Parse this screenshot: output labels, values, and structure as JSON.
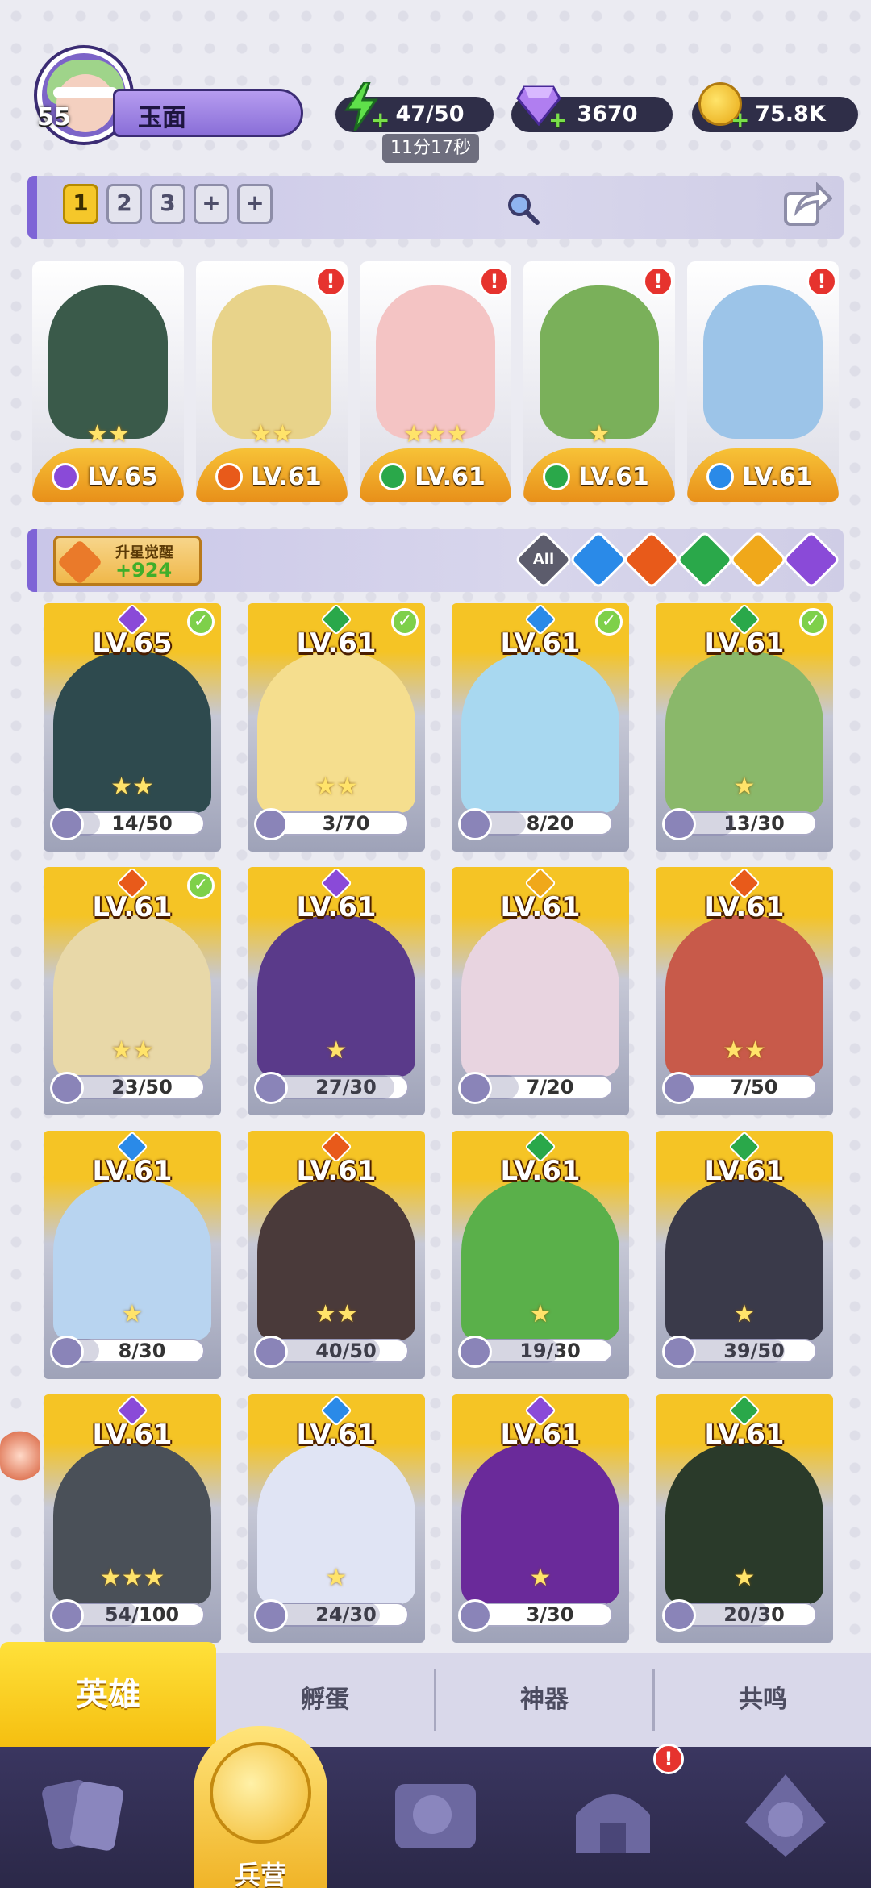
{
  "player": {
    "level": "55",
    "name": "玉面"
  },
  "resources": {
    "energy": "47/50",
    "energy_timer": "11分17秒",
    "gems": "3670",
    "gold": "75.8K"
  },
  "team_tabs": [
    {
      "label": "1",
      "active": true
    },
    {
      "label": "2"
    },
    {
      "label": "3"
    },
    {
      "label": "+"
    },
    {
      "label": "+"
    }
  ],
  "team": [
    {
      "level": "LV.65",
      "element": "dark",
      "stars": "★★",
      "alert": false,
      "color": "#3a5a4a"
    },
    {
      "level": "LV.61",
      "element": "fire",
      "stars": "★★",
      "alert": true,
      "color": "#e8d38a"
    },
    {
      "level": "LV.61",
      "element": "nature",
      "stars": "★★★",
      "alert": true,
      "color": "#f4c4c4"
    },
    {
      "level": "LV.61",
      "element": "nature",
      "stars": "★",
      "alert": true,
      "color": "#7ab05a"
    },
    {
      "level": "LV.61",
      "element": "water",
      "stars": "",
      "alert": true,
      "color": "#9cc4e8"
    }
  ],
  "awaken": {
    "title": "升星觉醒",
    "value": "+924"
  },
  "filters": [
    {
      "label": "All"
    },
    {
      "element": "water"
    },
    {
      "element": "fire"
    },
    {
      "element": "nature"
    },
    {
      "element": "light"
    },
    {
      "element": "dark"
    }
  ],
  "elements": {
    "dark": "#8a4ad8",
    "fire": "#e85a1a",
    "nature": "#2aa84a",
    "water": "#2a8ae8",
    "light": "#f0a81a"
  },
  "heroes": [
    {
      "level": "LV.65",
      "element": "dark",
      "progress": "14/50",
      "fill": 0.28,
      "stars": "★★",
      "check": true,
      "color": "#2e4a4e"
    },
    {
      "level": "LV.61",
      "element": "nature",
      "progress": "3/70",
      "fill": 0.04,
      "stars": "★★",
      "check": true,
      "color": "#f5de8e"
    },
    {
      "level": "LV.61",
      "element": "water",
      "progress": "8/20",
      "fill": 0.4,
      "stars": "",
      "check": true,
      "color": "#a8d8f0"
    },
    {
      "level": "LV.61",
      "element": "nature",
      "progress": "13/30",
      "fill": 0.43,
      "stars": "★",
      "check": true,
      "color": "#8ab86a"
    },
    {
      "level": "LV.61",
      "element": "fire",
      "progress": "23/50",
      "fill": 0.46,
      "stars": "★★",
      "check": true,
      "color": "#e8d8a8"
    },
    {
      "level": "LV.61",
      "element": "dark",
      "progress": "27/30",
      "fill": 0.9,
      "stars": "★",
      "check": false,
      "color": "#5a3a8a"
    },
    {
      "level": "LV.61",
      "element": "light",
      "progress": "7/20",
      "fill": 0.35,
      "stars": "",
      "check": false,
      "color": "#e8d4e0"
    },
    {
      "level": "LV.61",
      "element": "fire",
      "progress": "7/50",
      "fill": 0.14,
      "stars": "★★",
      "check": false,
      "color": "#c85a4a"
    },
    {
      "level": "LV.61",
      "element": "water",
      "progress": "8/30",
      "fill": 0.27,
      "stars": "★",
      "check": false,
      "color": "#b8d4f0"
    },
    {
      "level": "LV.61",
      "element": "fire",
      "progress": "40/50",
      "fill": 0.8,
      "stars": "★★",
      "check": false,
      "color": "#4a3a3a"
    },
    {
      "level": "LV.61",
      "element": "nature",
      "progress": "19/30",
      "fill": 0.63,
      "stars": "★",
      "check": false,
      "color": "#5ab04a"
    },
    {
      "level": "LV.61",
      "element": "nature",
      "progress": "39/50",
      "fill": 0.78,
      "stars": "★",
      "check": false,
      "color": "#3a3a4a"
    },
    {
      "level": "LV.61",
      "element": "dark",
      "progress": "54/100",
      "fill": 0.54,
      "stars": "★★★",
      "check": false,
      "color": "#4a5058"
    },
    {
      "level": "LV.61",
      "element": "water",
      "progress": "24/30",
      "fill": 0.8,
      "stars": "★",
      "check": false,
      "color": "#e0e4f4"
    },
    {
      "level": "LV.61",
      "element": "dark",
      "progress": "3/30",
      "fill": 0.1,
      "stars": "★",
      "check": false,
      "color": "#6a2a9a"
    },
    {
      "level": "LV.61",
      "element": "nature",
      "progress": "20/30",
      "fill": 0.67,
      "stars": "★",
      "check": false,
      "color": "#2a3a2a"
    }
  ],
  "tabs": [
    {
      "label": "英雄",
      "active": true
    },
    {
      "label": "孵蛋"
    },
    {
      "label": "神器"
    },
    {
      "label": "共鸣"
    }
  ],
  "nav": {
    "active_label": "兵营",
    "alert": "!"
  }
}
